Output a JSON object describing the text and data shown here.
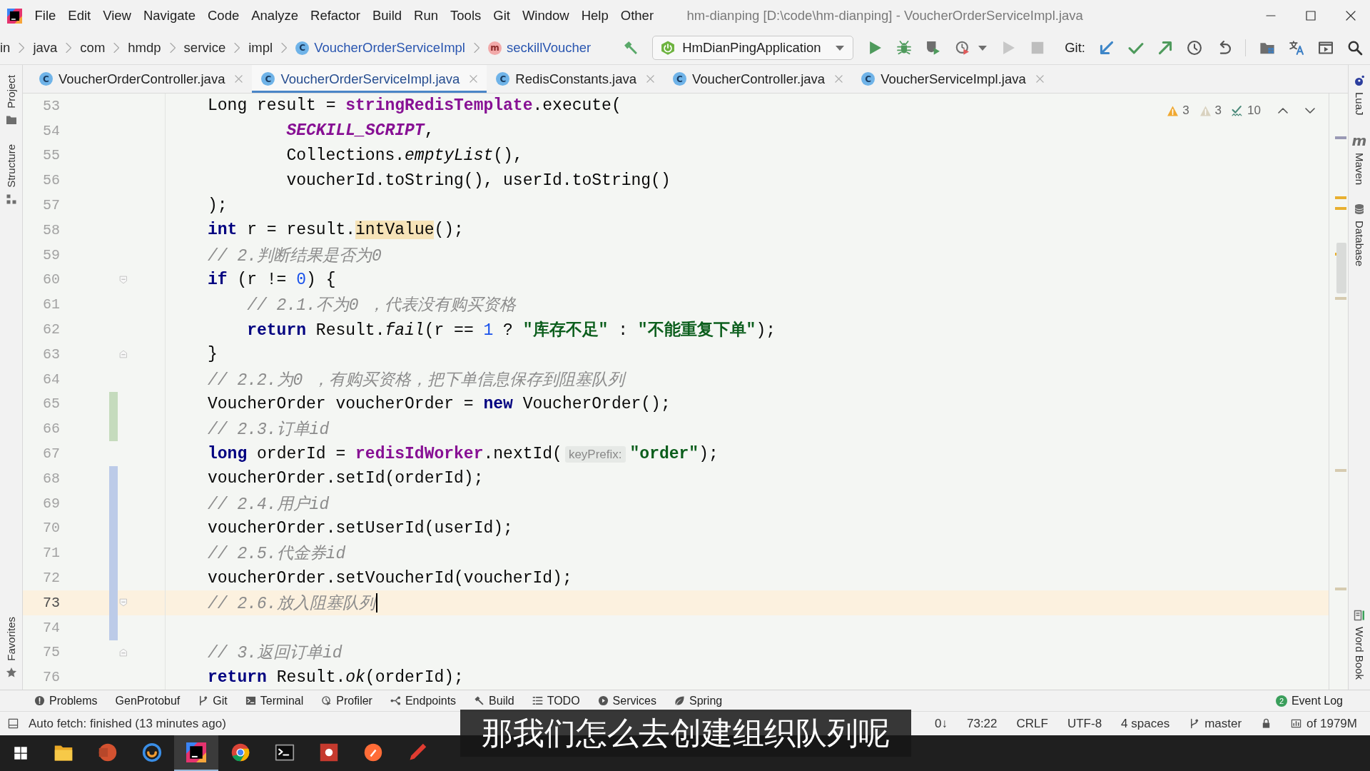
{
  "window": {
    "title": "hm-dianping [D:\\code\\hm-dianping] - VoucherOrderServiceImpl.java"
  },
  "menu": [
    "File",
    "Edit",
    "View",
    "Navigate",
    "Code",
    "Analyze",
    "Refactor",
    "Build",
    "Run",
    "Tools",
    "Git",
    "Window",
    "Help",
    "Other"
  ],
  "breadcrumbs": [
    {
      "label": "in",
      "kind": "folder"
    },
    {
      "label": "java",
      "kind": "folder"
    },
    {
      "label": "com",
      "kind": "folder"
    },
    {
      "label": "hmdp",
      "kind": "folder"
    },
    {
      "label": "service",
      "kind": "folder"
    },
    {
      "label": "impl",
      "kind": "folder"
    },
    {
      "label": "VoucherOrderServiceImpl",
      "kind": "class",
      "icon_letter": "C"
    },
    {
      "label": "seckillVoucher",
      "kind": "method",
      "icon_letter": "m"
    }
  ],
  "toolbar": [
    {
      "kind": "build",
      "disabled": false
    },
    {
      "kind": "run-config",
      "label": "HmDianPingApplication"
    },
    {
      "kind": "run",
      "disabled": false
    },
    {
      "kind": "debug",
      "disabled": false
    },
    {
      "kind": "coverage",
      "disabled": false
    },
    {
      "kind": "profile",
      "disabled": false
    },
    {
      "kind": "dropdown",
      "disabled": false
    },
    {
      "kind": "rerun",
      "disabled": true
    },
    {
      "kind": "stop",
      "disabled": true
    }
  ],
  "git": {
    "label": "Git:",
    "actions": [
      {
        "kind": "update"
      },
      {
        "kind": "commit"
      },
      {
        "kind": "push"
      },
      {
        "kind": "history"
      },
      {
        "kind": "rollback"
      }
    ]
  },
  "toolbar_right": [
    {
      "kind": "project-structure"
    },
    {
      "kind": "translate"
    },
    {
      "kind": "presentation"
    },
    {
      "kind": "search"
    }
  ],
  "tabs": [
    {
      "label": "VoucherOrderController.java",
      "icon_letter": "C",
      "selected": false
    },
    {
      "label": "VoucherOrderServiceImpl.java",
      "icon_letter": "C",
      "selected": true
    },
    {
      "label": "RedisConstants.java",
      "icon_letter": "C",
      "selected": false
    },
    {
      "label": "VoucherController.java",
      "icon_letter": "C",
      "selected": false
    },
    {
      "label": "VoucherServiceImpl.java",
      "icon_letter": "C",
      "selected": false
    }
  ],
  "left_strip": {
    "top": [
      {
        "label": "Project",
        "kind": "folder"
      },
      {
        "label": "Structure",
        "kind": "structure"
      }
    ],
    "bottom": [
      {
        "label": "Favorites",
        "kind": "star"
      }
    ]
  },
  "right_strip": {
    "top": [
      {
        "label": "LuaJ",
        "kind": "luaj"
      },
      {
        "label": "Maven",
        "kind": "maven",
        "icon_letter": "m"
      },
      {
        "label": "Database",
        "kind": "database"
      }
    ],
    "bottom": [
      {
        "label": "Word Book",
        "kind": "book"
      }
    ]
  },
  "inspections": [
    {
      "kind": "warning",
      "count": "3"
    },
    {
      "kind": "weak-warning",
      "count": "3"
    },
    {
      "kind": "typo",
      "count": "10"
    }
  ],
  "editor": {
    "lines": [
      {
        "number": "53",
        "current": false,
        "fold_start": false,
        "fold_end": false,
        "tokens": [
          {
            "kind": "plain",
            "text": "Long result = "
          },
          {
            "kind": "field",
            "text": "stringRedisTemplate"
          },
          {
            "kind": "plain",
            "text": ".execute("
          }
        ]
      },
      {
        "number": "54",
        "current": false,
        "fold_start": false,
        "fold_end": false,
        "tokens": [
          {
            "kind": "constant",
            "text": "        SECKILL_SCRIPT"
          },
          {
            "kind": "plain",
            "text": ","
          }
        ]
      },
      {
        "number": "55",
        "current": false,
        "fold_start": false,
        "fold_end": false,
        "tokens": [
          {
            "kind": "plain",
            "text": "        Collections."
          },
          {
            "kind": "call",
            "text": "emptyList"
          },
          {
            "kind": "plain",
            "text": "(),"
          }
        ]
      },
      {
        "number": "56",
        "current": false,
        "fold_start": false,
        "fold_end": false,
        "tokens": [
          {
            "kind": "plain",
            "text": "        voucherId.toString(), userId.toString()"
          }
        ]
      },
      {
        "number": "57",
        "current": false,
        "fold_start": false,
        "fold_end": false,
        "tokens": [
          {
            "kind": "plain",
            "text": ");"
          }
        ]
      },
      {
        "number": "58",
        "current": false,
        "fold_start": false,
        "fold_end": false,
        "tokens": [
          {
            "kind": "keyword",
            "text": "int"
          },
          {
            "kind": "plain",
            "text": " r = result."
          },
          {
            "kind": "usage",
            "text": "intValue"
          },
          {
            "kind": "plain",
            "text": "();"
          }
        ]
      },
      {
        "number": "59",
        "current": false,
        "fold_start": false,
        "fold_end": false,
        "tokens": [
          {
            "kind": "comment",
            "text": "// 2.判断结果是否为0"
          }
        ]
      },
      {
        "number": "60",
        "current": false,
        "fold_start": true,
        "fold_end": false,
        "tokens": [
          {
            "kind": "keyword",
            "text": "if"
          },
          {
            "kind": "plain",
            "text": " (r != "
          },
          {
            "kind": "number",
            "text": "0"
          },
          {
            "kind": "plain",
            "text": ") {"
          }
        ]
      },
      {
        "number": "61",
        "current": false,
        "fold_start": false,
        "fold_end": false,
        "tokens": [
          {
            "kind": "comment",
            "text": "    // 2.1.不为0 ，代表没有购买资格"
          }
        ]
      },
      {
        "number": "62",
        "current": false,
        "fold_start": false,
        "fold_end": false,
        "tokens": [
          {
            "kind": "keyword",
            "text": "    return"
          },
          {
            "kind": "plain",
            "text": " Result."
          },
          {
            "kind": "call",
            "text": "fail"
          },
          {
            "kind": "plain",
            "text": "(r == "
          },
          {
            "kind": "number",
            "text": "1"
          },
          {
            "kind": "plain",
            "text": " ? "
          },
          {
            "kind": "string",
            "text": "\"库存不足\""
          },
          {
            "kind": "plain",
            "text": " : "
          },
          {
            "kind": "string",
            "text": "\"不能重复下单\""
          },
          {
            "kind": "plain",
            "text": ");"
          }
        ]
      },
      {
        "number": "63",
        "current": false,
        "fold_start": false,
        "fold_end": true,
        "tokens": [
          {
            "kind": "plain",
            "text": "}"
          }
        ]
      },
      {
        "number": "64",
        "current": false,
        "fold_start": false,
        "fold_end": false,
        "tokens": [
          {
            "kind": "comment",
            "text": "// 2.2.为0 ，有购买资格，把下单信息保存到阻塞队列"
          }
        ]
      },
      {
        "number": "65",
        "current": false,
        "fold_start": false,
        "fold_end": false,
        "change_marker": {
          "color": "#c5dbbd"
        },
        "tokens": [
          {
            "kind": "plain",
            "text": "VoucherOrder voucherOrder = "
          },
          {
            "kind": "keyword",
            "text": "new"
          },
          {
            "kind": "plain",
            "text": " VoucherOrder();"
          }
        ]
      },
      {
        "number": "66",
        "current": false,
        "fold_start": false,
        "fold_end": false,
        "change_marker": {
          "color": "#c5dbbd"
        },
        "tokens": [
          {
            "kind": "comment",
            "text": "// 2.3.订单id"
          }
        ]
      },
      {
        "number": "67",
        "current": false,
        "fold_start": false,
        "fold_end": false,
        "tokens": [
          {
            "kind": "keyword",
            "text": "long"
          },
          {
            "kind": "plain",
            "text": " orderId = "
          },
          {
            "kind": "field",
            "text": "redisIdWorker"
          },
          {
            "kind": "plain",
            "text": ".nextId("
          },
          {
            "kind": "hint",
            "text": "keyPrefix:"
          },
          {
            "kind": "string",
            "text": "\"order\""
          },
          {
            "kind": "plain",
            "text": ");"
          }
        ]
      },
      {
        "number": "68",
        "current": false,
        "fold_start": false,
        "fold_end": false,
        "change_marker": {
          "color": "#bccbe8"
        },
        "tokens": [
          {
            "kind": "plain",
            "text": "voucherOrder.setId(orderId);"
          }
        ]
      },
      {
        "number": "69",
        "current": false,
        "fold_start": false,
        "fold_end": false,
        "change_marker": {
          "color": "#bccbe8"
        },
        "tokens": [
          {
            "kind": "comment",
            "text": "// 2.4.用户id"
          }
        ]
      },
      {
        "number": "70",
        "current": false,
        "fold_start": false,
        "fold_end": false,
        "change_marker": {
          "color": "#bccbe8"
        },
        "tokens": [
          {
            "kind": "plain",
            "text": "voucherOrder.setUserId(userId);"
          }
        ]
      },
      {
        "number": "71",
        "current": false,
        "fold_start": false,
        "fold_end": false,
        "change_marker": {
          "color": "#bccbe8"
        },
        "tokens": [
          {
            "kind": "comment",
            "text": "// 2.5.代金券id"
          }
        ]
      },
      {
        "number": "72",
        "current": false,
        "fold_start": false,
        "fold_end": false,
        "change_marker": {
          "color": "#bccbe8"
        },
        "tokens": [
          {
            "kind": "plain",
            "text": "voucherOrder.setVoucherId(voucherId);"
          }
        ]
      },
      {
        "number": "73",
        "current": true,
        "fold_start": true,
        "fold_end": false,
        "change_marker": {
          "color": "#bccbe8"
        },
        "tokens": [
          {
            "kind": "comment",
            "text": "// 2.6.放入阻塞队列"
          }
        ]
      },
      {
        "number": "74",
        "current": false,
        "fold_start": false,
        "fold_end": false,
        "change_marker": {
          "color": "#bccbe8"
        }
      },
      {
        "number": "75",
        "current": false,
        "fold_start": false,
        "fold_end": true,
        "tokens": [
          {
            "kind": "comment",
            "text": "// 3.返回订单id"
          }
        ]
      },
      {
        "number": "76",
        "current": false,
        "fold_start": false,
        "fold_end": false,
        "tokens": [
          {
            "kind": "keyword",
            "text": "return"
          },
          {
            "kind": "plain",
            "text": " Result."
          },
          {
            "kind": "call",
            "text": "ok"
          },
          {
            "kind": "plain",
            "text": "(orderId);"
          }
        ]
      }
    ]
  },
  "tool_windows": [
    {
      "label": "Problems",
      "kind": "problems"
    },
    {
      "label": "GenProtobuf",
      "kind": "plain"
    },
    {
      "label": "Git",
      "kind": "git"
    },
    {
      "label": "Terminal",
      "kind": "terminal"
    },
    {
      "label": "Profiler",
      "kind": "profiler"
    },
    {
      "label": "Endpoints",
      "kind": "endpoints"
    },
    {
      "label": "Build",
      "kind": "build"
    },
    {
      "label": "TODO",
      "kind": "todo"
    },
    {
      "label": "Services",
      "kind": "services"
    },
    {
      "label": "Spring",
      "kind": "spring"
    }
  ],
  "event_log": {
    "label": "Event Log",
    "count": "2"
  },
  "status_bar": {
    "message": "Auto fetch: finished (13 minutes ago)",
    "items": [
      {
        "kind": "text",
        "label": "0↓"
      },
      {
        "kind": "text",
        "label": "73:22"
      },
      {
        "kind": "text",
        "label": "CRLF"
      },
      {
        "kind": "text",
        "label": "UTF-8"
      },
      {
        "kind": "text",
        "label": "4 spaces"
      },
      {
        "kind": "branch",
        "label": "master"
      },
      {
        "kind": "lock"
      },
      {
        "kind": "memory",
        "label": "of 1979M"
      }
    ]
  },
  "taskbar": {
    "apps": [
      {
        "kind": "explorer",
        "selected": false
      },
      {
        "kind": "slides",
        "selected": false
      },
      {
        "kind": "ring",
        "selected": false
      },
      {
        "kind": "ide",
        "selected": true
      },
      {
        "kind": "browser",
        "selected": false
      },
      {
        "kind": "terminal",
        "selected": false
      },
      {
        "kind": "tile",
        "selected": false
      },
      {
        "kind": "orb",
        "selected": false
      },
      {
        "kind": "pen",
        "selected": false
      }
    ]
  },
  "subtitle": "那我们怎么去创建组织队列呢"
}
